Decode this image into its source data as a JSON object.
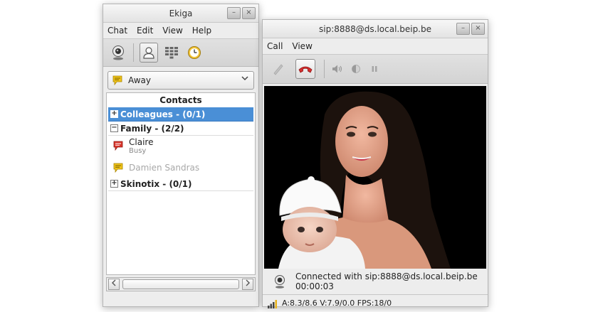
{
  "main_window": {
    "title": "Ekiga",
    "menu": [
      "Chat",
      "Edit",
      "View",
      "Help"
    ],
    "presence": {
      "label": "Away",
      "icon": "away-bubble-icon"
    },
    "roster": {
      "header": "Contacts",
      "groups": [
        {
          "label": "Colleagues - (0/1)",
          "expanded": false,
          "selected": true
        },
        {
          "label": "Family - (2/2)",
          "expanded": true,
          "selected": false
        },
        {
          "label": "Skinotix - (0/1)",
          "expanded": false,
          "selected": false
        }
      ],
      "contacts": [
        {
          "name": "Claire",
          "status": "Busy",
          "icon": "busy-bubble-icon"
        },
        {
          "name": "Damien Sandras",
          "status": "",
          "icon": "away-bubble-icon"
        }
      ]
    },
    "expander_collapsed": "+",
    "expander_expanded": "−"
  },
  "call_window": {
    "title": "sip:8888@ds.local.beip.be",
    "menu": [
      "Call",
      "View"
    ],
    "status_line1": "Connected with sip:8888@ds.local.beip.be",
    "status_line2": "00:00:03",
    "stats": "A:8.3/8.6 V:7.9/0.0 FPS:18/0"
  },
  "window_buttons": {
    "minimize": "–",
    "close": "×"
  },
  "colors": {
    "selection": "#4a8fd6",
    "away": "#f0c419",
    "busy": "#d9352b",
    "hangup": "#d62f2f"
  }
}
